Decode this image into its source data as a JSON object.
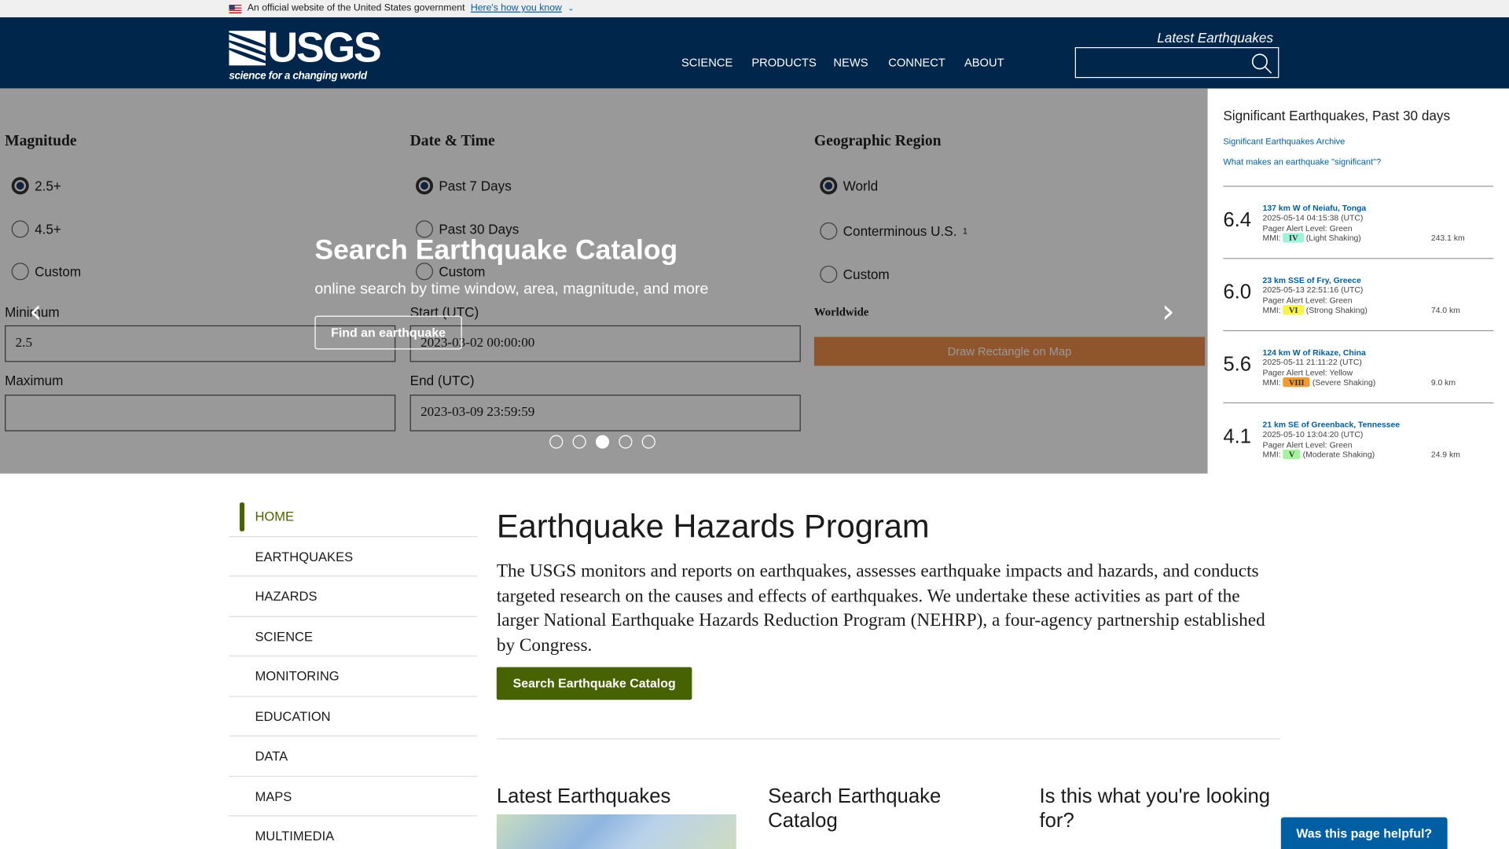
{
  "gov_banner": {
    "text": "An official website of the United States government",
    "link": "Here's how you know"
  },
  "header": {
    "logo": "USGS",
    "tagline": "science for a changing world",
    "nav": [
      "SCIENCE",
      "PRODUCTS",
      "NEWS",
      "CONNECT",
      "ABOUT"
    ],
    "latest_link": "Latest Earthquakes",
    "search_placeholder": ""
  },
  "hero": {
    "background_form": {
      "magnitude": "Magnitude",
      "mag_options": [
        "2.5+",
        "4.5+",
        "Custom"
      ],
      "datetime": "Date & Time",
      "date_options": [
        "Past 7 Days",
        "Past 30 Days",
        "Custom"
      ],
      "region": "Geographic Region",
      "region_options": [
        "World",
        "Conterminous U.S.",
        "Custom"
      ],
      "region_sup": "1",
      "minimum": "Minimum",
      "minimum_value": "2.5",
      "maximum": "Maximum",
      "start": "Start (UTC)",
      "start_value": "2023-03-02 00:00:00",
      "end": "End (UTC)",
      "end_value": "2023-03-09 23:59:59",
      "worldwide": "Worldwide",
      "draw_rect": "Draw Rectangle on Map"
    },
    "title": "Search Earthquake Catalog",
    "subtitle": "online search by time window, area, magnitude, and more",
    "button": "Find an earthquake",
    "slide_count": 5,
    "active_slide": 3
  },
  "significant": {
    "title": "Significant Earthquakes, Past 30 days",
    "links": [
      "Significant Earthquakes Archive",
      "What makes an earthquake \"significant\"?"
    ],
    "quakes": [
      {
        "mag": "6.4",
        "title": "137 km W of Neiafu, Tonga",
        "time": "2025-05-14 04:15:38 (UTC)",
        "pager": "Pager Alert Level: Green",
        "mmi": "IV",
        "mmi_color": "#9cf3d8",
        "shaking": "(Light Shaking)",
        "depth": "243.1 km"
      },
      {
        "mag": "6.0",
        "title": "23 km SSE of Fry, Greece",
        "time": "2025-05-13 22:51:16 (UTC)",
        "pager": "Pager Alert Level: Green",
        "mmi": "VI",
        "mmi_color": "#f5f542",
        "shaking": "(Strong Shaking)",
        "depth": "74.0 km"
      },
      {
        "mag": "5.6",
        "title": "124 km W of Rikaze, China",
        "time": "2025-05-11 21:11:22 (UTC)",
        "pager": "Pager Alert Level: Yellow",
        "mmi": "VIII",
        "mmi_color": "#f09a32",
        "shaking": "(Severe Shaking)",
        "depth": "9.0 km"
      },
      {
        "mag": "4.1",
        "title": "21 km SE of Greenback, Tennessee",
        "time": "2025-05-10 13:04:20 (UTC)",
        "pager": "Pager Alert Level: Green",
        "mmi": "V",
        "mmi_color": "#a2f59c",
        "shaking": "(Moderate Shaking)",
        "depth": "24.9 km"
      }
    ]
  },
  "sidebar": [
    "HOME",
    "EARTHQUAKES",
    "HAZARDS",
    "SCIENCE",
    "MONITORING",
    "EDUCATION",
    "DATA",
    "MAPS",
    "MULTIMEDIA"
  ],
  "main": {
    "title": "Earthquake Hazards Program",
    "body": "The USGS monitors and reports on earthquakes, assesses earthquake impacts and hazards, and conducts targeted research on the causes and effects of earthquakes. We undertake these activities as part of the larger National Earthquake Hazards Reduction Program (NEHRP), a four-agency partnership established by Congress.",
    "button": "Search Earthquake Catalog"
  },
  "cards": [
    "Latest Earthquakes",
    "Search Earthquake Catalog",
    "Is this what you're looking for?"
  ],
  "helpful": "Was this page helpful?",
  "colors": {
    "header": "#00264c",
    "green": "#476200",
    "link": "#005ea2"
  }
}
